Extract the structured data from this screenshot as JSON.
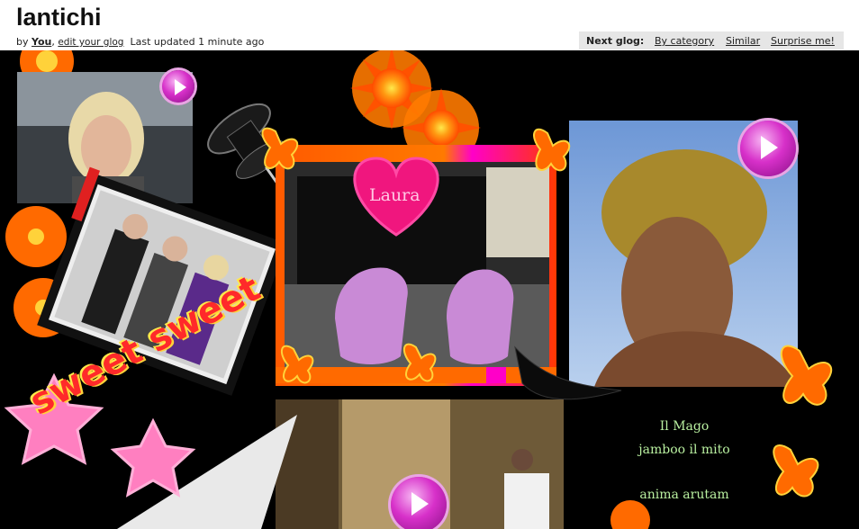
{
  "header": {
    "title": "lantichi",
    "by_prefix": "by",
    "author": "You",
    "comma": ",",
    "edit_link": "edit your glog",
    "updated": "Last updated 1 minute ago"
  },
  "next_glog": {
    "label": "Next glog:",
    "by_category": "By category",
    "similar": "Similar",
    "surprise": "Surprise me!"
  },
  "glog": {
    "heart_text": "Laura",
    "sweet_text": "sweet sweet",
    "captions": [
      "Il Mago",
      "jamboo il mito",
      "anima arutam"
    ]
  },
  "colors": {
    "background": "#000000",
    "play_button": "#d730c9",
    "caption_green": "#b9f0a0",
    "heart_pink": "#f0167e"
  }
}
